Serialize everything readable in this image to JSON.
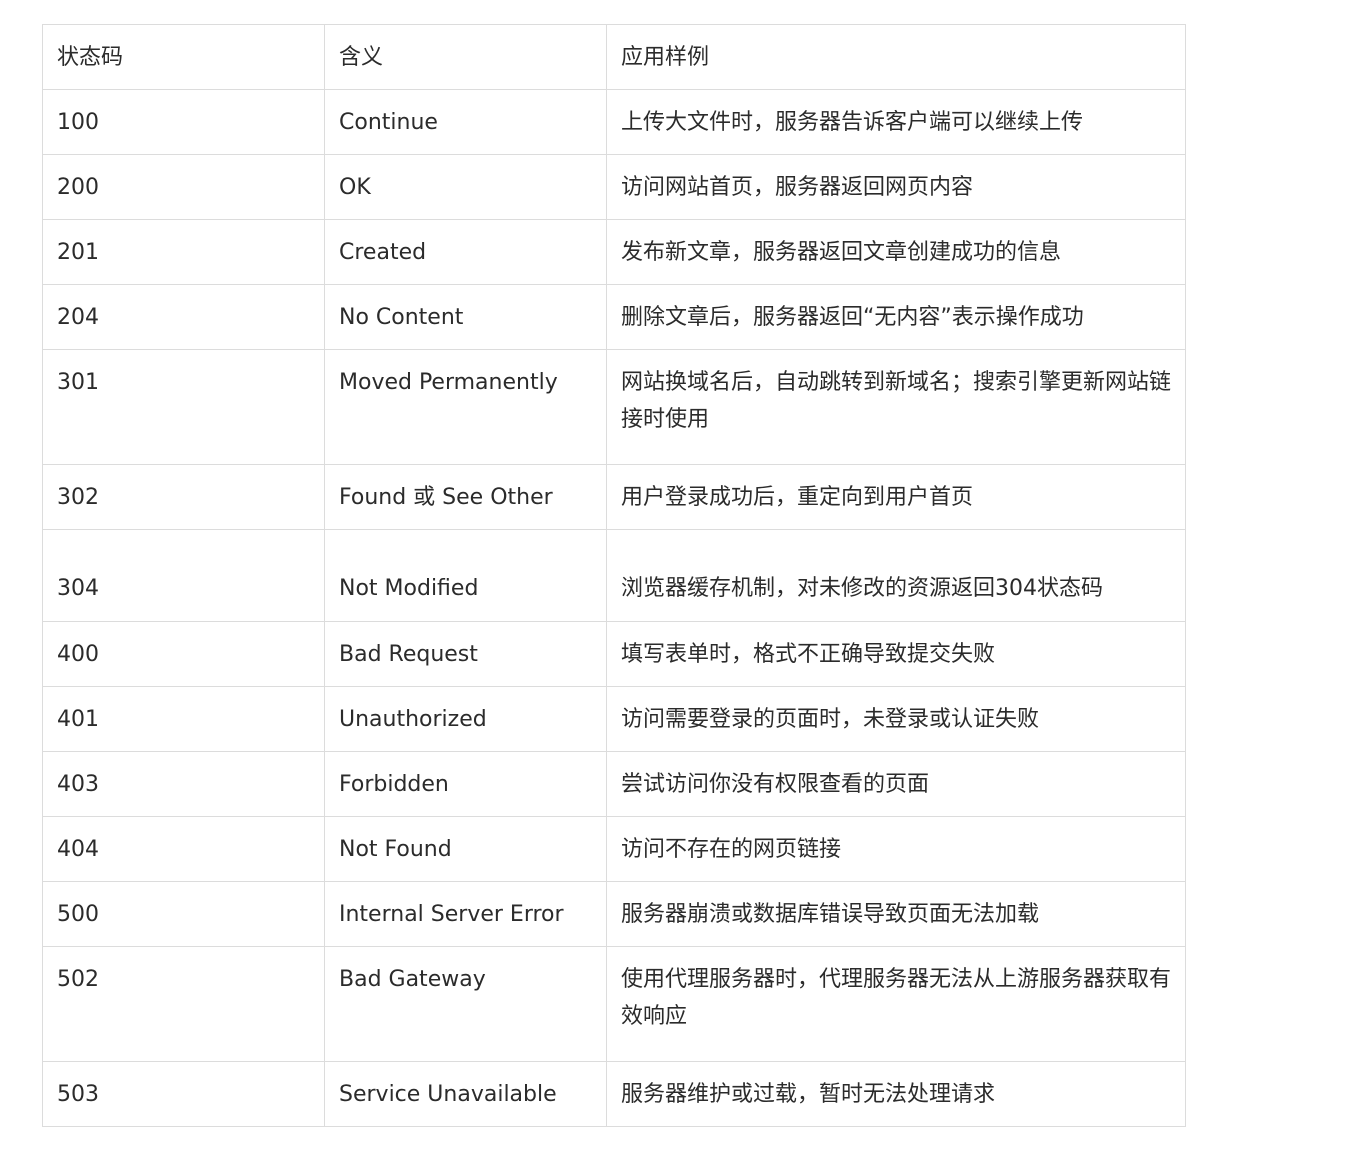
{
  "table": {
    "headers": [
      "状态码",
      "含义",
      "应用样例"
    ],
    "rows": [
      {
        "code": "100",
        "meaning": "Continue",
        "example": "上传大文件时，服务器告诉客户端可以继续上传"
      },
      {
        "code": "200",
        "meaning": "OK",
        "example": "访问网站首页，服务器返回网页内容"
      },
      {
        "code": "201",
        "meaning": "Created",
        "example": "发布新文章，服务器返回文章创建成功的信息"
      },
      {
        "code": "204",
        "meaning": "No Content",
        "example": "删除文章后，服务器返回“无内容”表示操作成功"
      },
      {
        "code": "301",
        "meaning": "Moved Permanently",
        "example": "网站换域名后，自动跳转到新域名；搜索引擎更新网站链接时使用"
      },
      {
        "code": "302",
        "meaning": "Found 或 See Other",
        "example": "用户登录成功后，重定向到用户首页"
      },
      {
        "code": "304",
        "meaning": "Not Modified",
        "example": "浏览器缓存机制，对未修改的资源返回304状态码"
      },
      {
        "code": "400",
        "meaning": "Bad Request",
        "example": "填写表单时，格式不正确导致提交失败"
      },
      {
        "code": "401",
        "meaning": "Unauthorized",
        "example": "访问需要登录的页面时，未登录或认证失败"
      },
      {
        "code": "403",
        "meaning": "Forbidden",
        "example": "尝试访问你没有权限查看的页面"
      },
      {
        "code": "404",
        "meaning": "Not Found",
        "example": "访问不存在的网页链接"
      },
      {
        "code": "500",
        "meaning": "Internal Server Error",
        "example": "服务器崩溃或数据库错误导致页面无法加载"
      },
      {
        "code": "502",
        "meaning": "Bad Gateway",
        "example": "使用代理服务器时，代理服务器无法从上游服务器获取有效响应"
      },
      {
        "code": "503",
        "meaning": "Service Unavailable",
        "example": "服务器维护或过载，暂时无法处理请求"
      }
    ]
  }
}
